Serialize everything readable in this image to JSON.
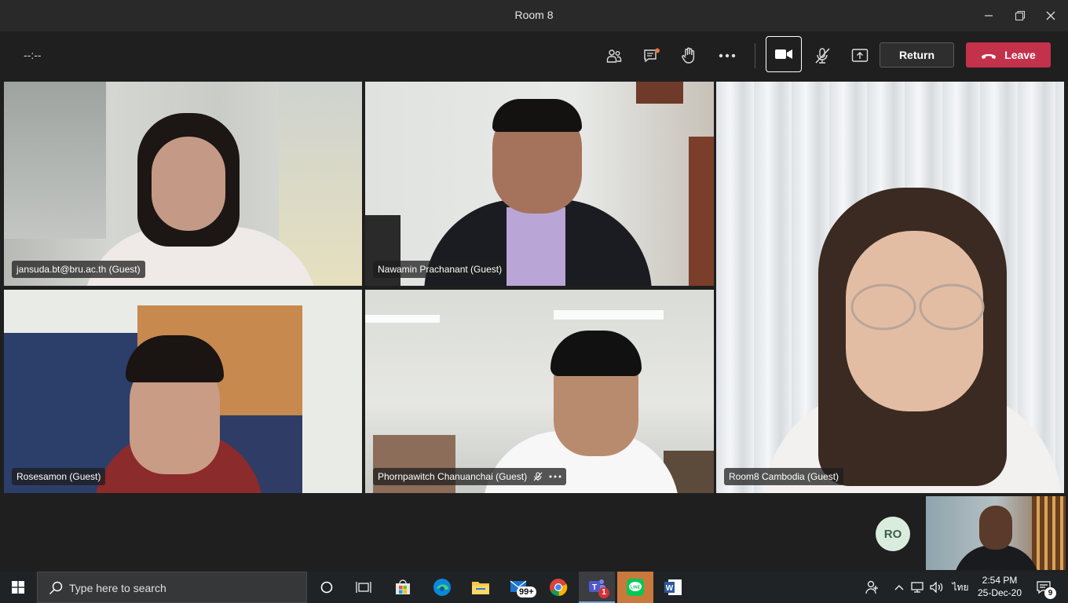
{
  "window": {
    "title": "Room 8"
  },
  "toolbar": {
    "timer": "--:--",
    "return_label": "Return",
    "leave_label": "Leave"
  },
  "participants": [
    {
      "name": "jansuda.bt@bru.ac.th (Guest)"
    },
    {
      "name": "Nawamin Prachanant (Guest)"
    },
    {
      "name": "Room8 Cambodia (Guest)"
    },
    {
      "name": "Rosesamon (Guest)"
    },
    {
      "name": "Phornpawitch Chanuanchai (Guest)"
    }
  ],
  "self_view": {
    "avatar_initials": "RO"
  },
  "taskbar": {
    "search_placeholder": "Type here to search",
    "mail_badge": "99+",
    "teams_badge": "1",
    "language": "ไทย",
    "time": "2:54 PM",
    "date": "25-Dec-20",
    "notifications_count": "9"
  },
  "colors": {
    "leave": "#c4314b",
    "accent": "#6264a7"
  }
}
